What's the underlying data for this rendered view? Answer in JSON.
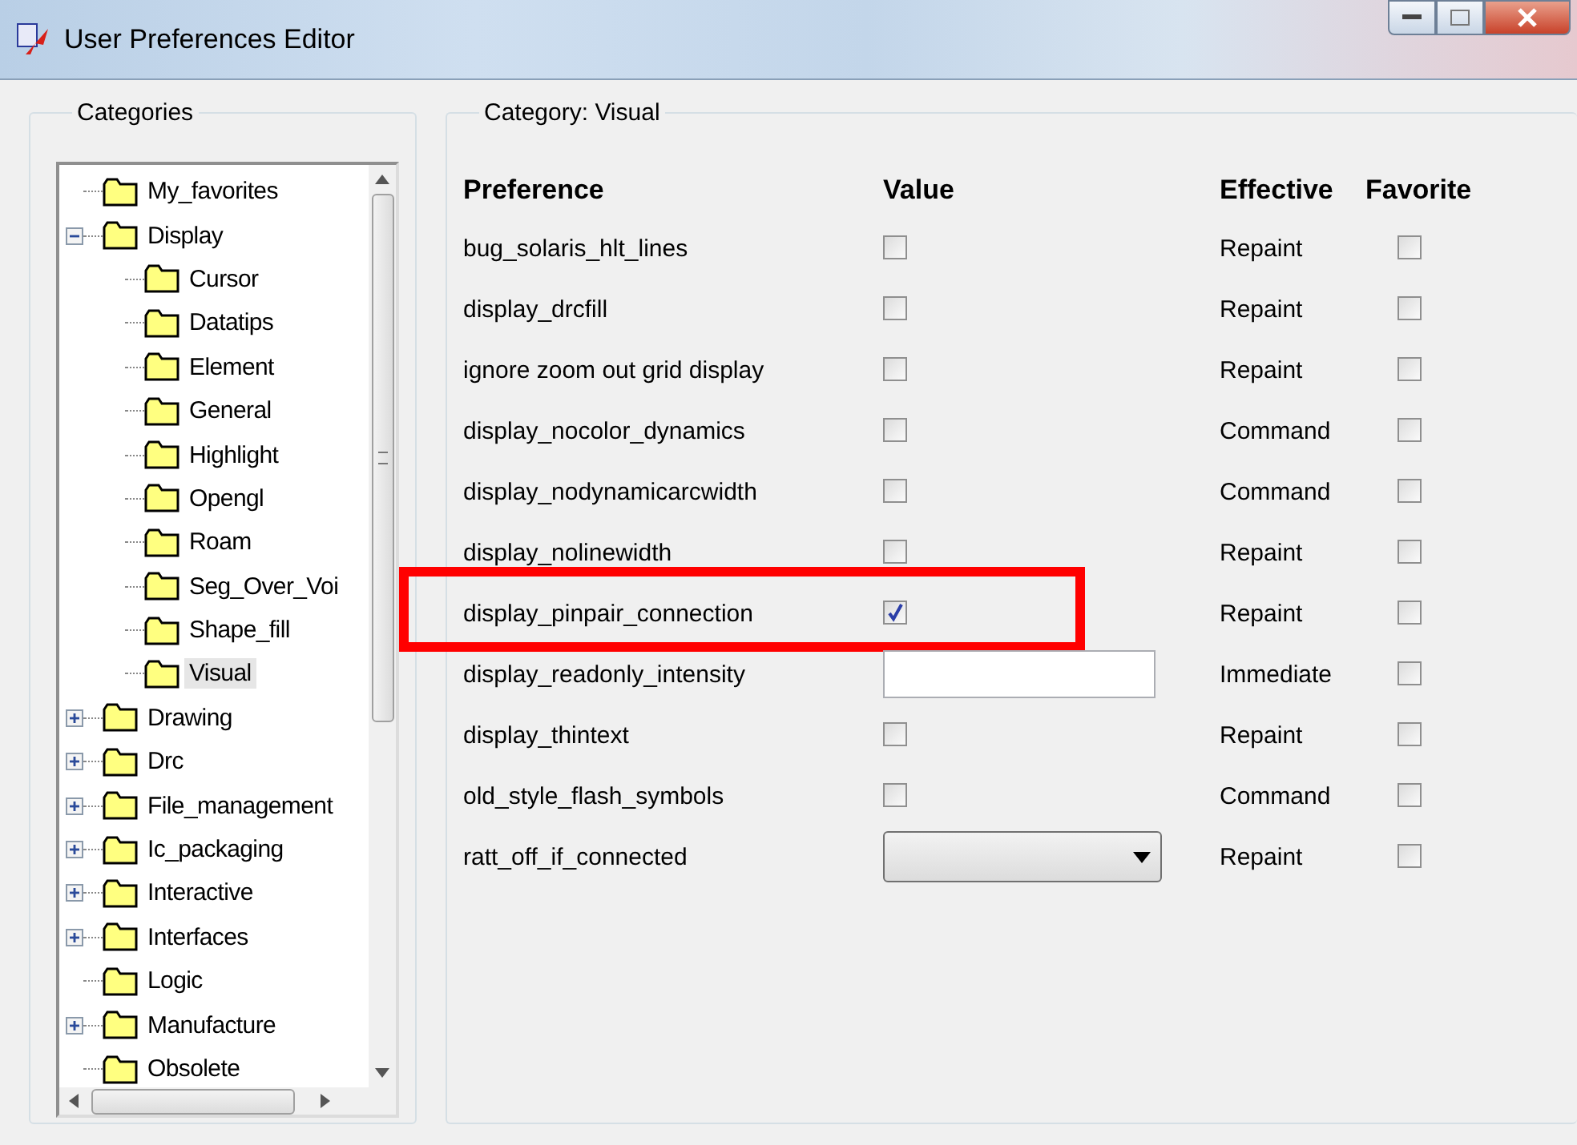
{
  "window": {
    "title": "User Preferences Editor"
  },
  "categories": {
    "title": "Categories",
    "items": [
      {
        "label": "My_favorites",
        "selected": false
      },
      {
        "label": "Display",
        "selected": false,
        "expanded": true,
        "children": [
          {
            "label": "Cursor",
            "selected": false
          },
          {
            "label": "Datatips",
            "selected": false
          },
          {
            "label": "Element",
            "selected": false
          },
          {
            "label": "General",
            "selected": false
          },
          {
            "label": "Highlight",
            "selected": false
          },
          {
            "label": "Opengl",
            "selected": false
          },
          {
            "label": "Roam",
            "selected": false
          },
          {
            "label": "Seg_Over_Voi",
            "selected": false
          },
          {
            "label": "Shape_fill",
            "selected": false
          },
          {
            "label": "Visual",
            "selected": true
          }
        ]
      },
      {
        "label": "Drawing",
        "selected": false,
        "expanded": false
      },
      {
        "label": "Drc",
        "selected": false,
        "expanded": false
      },
      {
        "label": "File_management",
        "selected": false,
        "expanded": false
      },
      {
        "label": "Ic_packaging",
        "selected": false,
        "expanded": false
      },
      {
        "label": "Interactive",
        "selected": false,
        "expanded": false
      },
      {
        "label": "Interfaces",
        "selected": false,
        "expanded": false
      },
      {
        "label": "Logic",
        "selected": false
      },
      {
        "label": "Manufacture",
        "selected": false,
        "expanded": false
      },
      {
        "label": "Obsolete",
        "selected": false
      }
    ]
  },
  "category": {
    "title": "Category:  Visual",
    "columns": [
      "Preference",
      "Value",
      "Effective",
      "Favorite"
    ],
    "rows": [
      {
        "name": "bug_solaris_hlt_lines",
        "kind": "checkbox",
        "checked": false,
        "effective": "Repaint",
        "favorite": false
      },
      {
        "name": "display_drcfill",
        "kind": "checkbox",
        "checked": false,
        "effective": "Repaint",
        "favorite": false
      },
      {
        "name": "ignore zoom out grid display",
        "kind": "checkbox",
        "checked": false,
        "effective": "Repaint",
        "favorite": false
      },
      {
        "name": "display_nocolor_dynamics",
        "kind": "checkbox",
        "checked": false,
        "effective": "Command",
        "favorite": false
      },
      {
        "name": "display_nodynamicarcwidth",
        "kind": "checkbox",
        "checked": false,
        "effective": "Command",
        "favorite": false
      },
      {
        "name": "display_nolinewidth",
        "kind": "checkbox",
        "checked": false,
        "effective": "Repaint",
        "favorite": false
      },
      {
        "name": "display_pinpair_connection",
        "kind": "checkbox",
        "checked": true,
        "effective": "Repaint",
        "favorite": false,
        "highlighted": true
      },
      {
        "name": "display_readonly_intensity",
        "kind": "text",
        "effective": "Immediate",
        "favorite": false
      },
      {
        "name": "display_thintext",
        "kind": "checkbox",
        "checked": false,
        "effective": "Repaint",
        "favorite": false
      },
      {
        "name": "old_style_flash_symbols",
        "kind": "checkbox",
        "checked": false,
        "effective": "Command",
        "favorite": false
      },
      {
        "name": "ratt_off_if_connected",
        "kind": "dropdown",
        "effective": "Repaint",
        "favorite": false
      }
    ]
  }
}
